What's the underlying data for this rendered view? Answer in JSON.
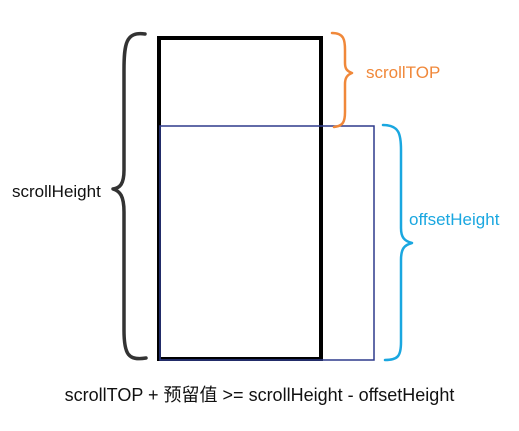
{
  "labels": {
    "scroll_height": "scrollHeight",
    "scroll_top": "scrollTOP",
    "offset_height": "offsetHeight"
  },
  "formula": "scrollTOP + 预留值 >= scrollHeight - offsetHeight",
  "colors": {
    "content_box": "#000000",
    "viewport_box": "#2e3a8c",
    "scroll_height_brace": "#333333",
    "scroll_top": "#f0883a",
    "offset_height": "#1aa7e0"
  }
}
